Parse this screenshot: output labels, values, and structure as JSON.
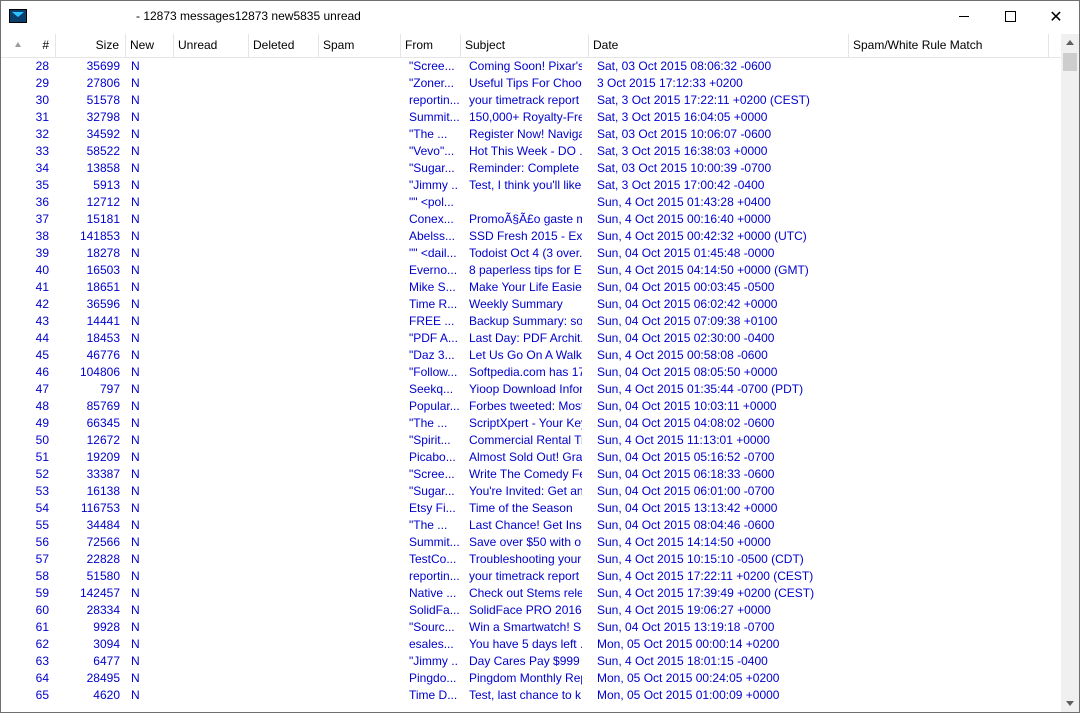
{
  "window": {
    "title": "- 12873 messages12873 new5835 unread",
    "minimize_glyph": "minimize-icon",
    "maximize_glyph": "maximize-icon",
    "close_glyph": "✕"
  },
  "columns": {
    "sort_icon": "sort-ascending-icon",
    "num": "#",
    "size": "Size",
    "new": "New",
    "unread": "Unread",
    "deleted": "Deleted",
    "spam": "Spam",
    "from": "From",
    "subject": "Subject",
    "date": "Date",
    "rule": "Spam/White Rule Match"
  },
  "colors": {
    "row_text": "#0000cc"
  },
  "messages": [
    {
      "num": "28",
      "size": "35699",
      "new": "N",
      "from": "\"Scree...",
      "subject": "Coming Soon! Pixar's ...",
      "date": "Sat, 03 Oct 2015 08:06:32 -0600"
    },
    {
      "num": "29",
      "size": "27806",
      "new": "N",
      "from": "\"Zoner...",
      "subject": "Useful Tips For Choos...",
      "date": "3 Oct 2015 17:12:33 +0200"
    },
    {
      "num": "30",
      "size": "51578",
      "new": "N",
      "from": "reportin...",
      "subject": "your timetrack report ...",
      "date": "Sat, 3 Oct 2015 17:22:11 +0200 (CEST)"
    },
    {
      "num": "31",
      "size": "32798",
      "new": "N",
      "from": "Summit...",
      "subject": " 150,000+ Royalty-Fre...",
      "date": "Sat, 3 Oct 2015 16:04:05 +0000"
    },
    {
      "num": "32",
      "size": "34592",
      "new": "N",
      "from": "\"The ...",
      "subject": "Register Now! Naviga...",
      "date": "Sat, 03 Oct 2015 10:06:07 -0600"
    },
    {
      "num": "33",
      "size": "58522",
      "new": "N",
      "from": "\"Vevo\"...",
      "subject": "Hot This Week - DO ...",
      "date": "Sat, 3 Oct 2015 16:38:03 +0000"
    },
    {
      "num": "34",
      "size": "13858",
      "new": "N",
      "from": "\"Sugar...",
      "subject": "Reminder: Complete y...",
      "date": "Sat, 03 Oct 2015 10:00:39 -0700"
    },
    {
      "num": "35",
      "size": "5913",
      "new": "N",
      "from": "\"Jimmy ...",
      "subject": "Test, I think you'll like ...",
      "date": "Sat, 3 Oct 2015 17:00:42 -0400"
    },
    {
      "num": "36",
      "size": "12712",
      "new": "N",
      "from": "\"\"  <pol...",
      "subject": "",
      "date": "Sun, 4 Oct 2015 01:43:28 +0400"
    },
    {
      "num": "37",
      "size": "15181",
      "new": "N",
      "from": "Conex...",
      "subject": "PromoÃ§Ã£o gaste m...",
      "date": "Sun, 4 Oct 2015 00:16:40 +0000"
    },
    {
      "num": "38",
      "size": "141853",
      "new": "N",
      "from": "Abelss...",
      "subject": "SSD Fresh 2015 - Ext...",
      "date": "Sun, 4 Oct 2015 00:42:32 +0000 (UTC)"
    },
    {
      "num": "39",
      "size": "18278",
      "new": "N",
      "from": "\"\" <dail...",
      "subject": "Todoist Oct 4 (3 over...",
      "date": "Sun, 04 Oct 2015 01:45:48 -0000"
    },
    {
      "num": "40",
      "size": "16503",
      "new": "N",
      "from": "Everno...",
      "subject": "8 paperless tips for Ev...",
      "date": "Sun, 4 Oct 2015 04:14:50 +0000 (GMT)"
    },
    {
      "num": "41",
      "size": "18651",
      "new": "N",
      "from": "Mike S...",
      "subject": "Make Your Life Easier...",
      "date": "Sun, 04 Oct 2015 00:03:45 -0500"
    },
    {
      "num": "42",
      "size": "36596",
      "new": "N",
      "from": "Time R...",
      "subject": "Weekly Summary",
      "date": "Sun, 04 Oct 2015 06:02:42 +0000"
    },
    {
      "num": "43",
      "size": "14441",
      "new": "N",
      "from": "FREE ...",
      "subject": "Backup Summary:  so...",
      "date": "Sun, 04 Oct 2015 07:09:38 +0100"
    },
    {
      "num": "44",
      "size": "18453",
      "new": "N",
      "from": "\"PDF A...",
      "subject": "Last Day: PDF Archit...",
      "date": "Sun, 04 Oct 2015 02:30:00 -0400"
    },
    {
      "num": "45",
      "size": "46776",
      "new": "N",
      "from": "\"Daz 3...",
      "subject": "Let Us Go On A Walk...",
      "date": "Sun, 4 Oct 2015 00:58:08 -0600"
    },
    {
      "num": "46",
      "size": "104806",
      "new": "N",
      "from": "\"Follow...",
      "subject": "Softpedia.com has 17...",
      "date": "Sun, 04 Oct 2015 08:05:50 +0000"
    },
    {
      "num": "47",
      "size": "797",
      "new": "N",
      "from": "Seekq...",
      "subject": "Yioop Download Infor...",
      "date": "Sun,  4 Oct 2015 01:35:44 -0700 (PDT)"
    },
    {
      "num": "48",
      "size": "85769",
      "new": "N",
      "from": "Popular...",
      "subject": "Forbes tweeted: Most...",
      "date": "Sun, 04 Oct 2015 10:03:11 +0000"
    },
    {
      "num": "49",
      "size": "66345",
      "new": "N",
      "from": "\"The ...",
      "subject": "ScriptXpert - Your Key...",
      "date": "Sun, 04 Oct 2015 04:08:02 -0600"
    },
    {
      "num": "50",
      "size": "12672",
      "new": "N",
      "from": "\"Spirit...",
      "subject": "Commercial Rental Tr...",
      "date": "Sun, 4 Oct 2015 11:13:01 +0000"
    },
    {
      "num": "51",
      "size": "19209",
      "new": "N",
      "from": "Picabo...",
      "subject": "Almost Sold Out! Grab...",
      "date": "Sun, 04 Oct 2015 05:16:52 -0700"
    },
    {
      "num": "52",
      "size": "33387",
      "new": "N",
      "from": "\"Scree...",
      "subject": "Write The Comedy Fe...",
      "date": "Sun, 04 Oct 2015 06:18:33 -0600"
    },
    {
      "num": "53",
      "size": "16138",
      "new": "N",
      "from": "\"Sugar...",
      "subject": "You're Invited: Get an...",
      "date": "Sun, 04 Oct 2015 06:01:00 -0700"
    },
    {
      "num": "54",
      "size": "116753",
      "new": "N",
      "from": "Etsy Fi...",
      "subject": "Time of the Season",
      "date": "Sun, 04 Oct 2015 13:13:42 +0000"
    },
    {
      "num": "55",
      "size": "34484",
      "new": "N",
      "from": "\"The ...",
      "subject": "Last Chance! Get Ins...",
      "date": "Sun, 04 Oct 2015 08:04:46 -0600"
    },
    {
      "num": "56",
      "size": "72566",
      "new": "N",
      "from": "Summit...",
      "subject": " Save over $50 with o...",
      "date": "Sun, 4 Oct 2015 14:14:50 +0000"
    },
    {
      "num": "57",
      "size": "22828",
      "new": "N",
      "from": "TestCo...",
      "subject": "Troubleshooting your ...",
      "date": "Sun, 4 Oct 2015 10:15:10 -0500 (CDT)"
    },
    {
      "num": "58",
      "size": "51580",
      "new": "N",
      "from": "reportin...",
      "subject": "your timetrack report ...",
      "date": "Sun, 4 Oct 2015 17:22:11 +0200 (CEST)"
    },
    {
      "num": "59",
      "size": "142457",
      "new": "N",
      "from": "Native ...",
      "subject": "Check out Stems rele...",
      "date": "Sun, 4 Oct 2015 17:39:49 +0200 (CEST)"
    },
    {
      "num": "60",
      "size": "28334",
      "new": "N",
      "from": "SolidFa...",
      "subject": " SolidFace PRO 2016...",
      "date": "Sun, 4 Oct 2015 19:06:27 +0000"
    },
    {
      "num": "61",
      "size": "9928",
      "new": "N",
      "from": "\"Sourc...",
      "subject": "Win a Smartwatch! S...",
      "date": "Sun, 04 Oct 2015 13:19:18 -0700"
    },
    {
      "num": "62",
      "size": "3094",
      "new": "N",
      "from": "esales...",
      "subject": "You have 5 days left ...",
      "date": "Mon, 05 Oct 2015 00:00:14 +0200"
    },
    {
      "num": "63",
      "size": "6477",
      "new": "N",
      "from": "\"Jimmy ...",
      "subject": "Day Cares Pay $999 ...",
      "date": "Sun, 4 Oct 2015 18:01:15 -0400"
    },
    {
      "num": "64",
      "size": "28495",
      "new": "N",
      "from": "Pingdo...",
      "subject": "Pingdom Monthly Rep...",
      "date": "Mon, 05 Oct 2015 00:24:05 +0200"
    },
    {
      "num": "65",
      "size": "4620",
      "new": "N",
      "from": "Time D...",
      "subject": "Test, last chance to k...",
      "date": "Mon, 05 Oct 2015 01:00:09 +0000"
    }
  ]
}
